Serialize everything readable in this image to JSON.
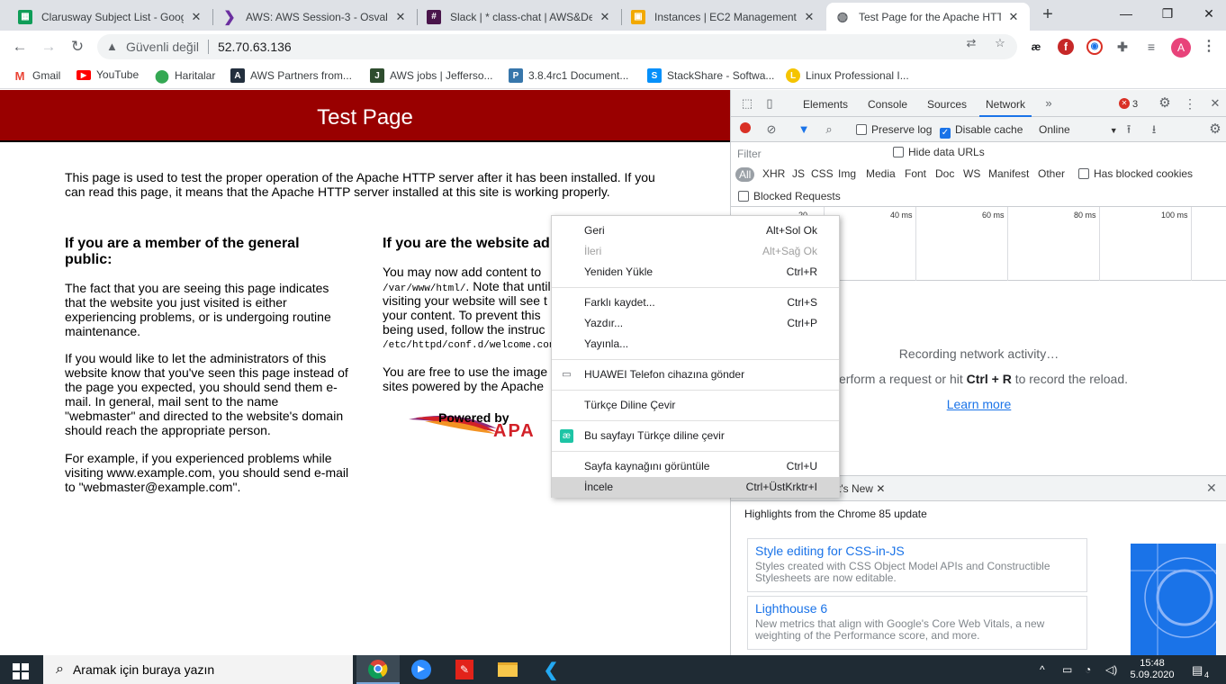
{
  "tabs": [
    {
      "title": "Clarusway Subject List - Google",
      "icon": "sheets-icon",
      "color": "#0f9d58"
    },
    {
      "title": "AWS: AWS Session-3 - Osvaldo",
      "icon": "aws-session-icon",
      "color": "#6b2fa0"
    },
    {
      "title": "Slack | * class-chat | AWS&Dev",
      "icon": "slack-icon",
      "color": "#4a154b"
    },
    {
      "title": "Instances | EC2 Management C",
      "icon": "ec2-icon",
      "color": "#f2a900"
    },
    {
      "title": "Test Page for the Apache HTTP",
      "icon": "globe-icon",
      "color": "#5f6368"
    }
  ],
  "toolbar": {
    "security_label": "Güvenli değil",
    "url": "52.70.63.136"
  },
  "bookmarks": [
    {
      "label": "Gmail",
      "icon": "gmail-icon",
      "color": "#ea4335",
      "glyph": "M"
    },
    {
      "label": "YouTube",
      "icon": "youtube-icon",
      "color": "#ff0000",
      "glyph": "▶"
    },
    {
      "label": "Haritalar",
      "icon": "maps-icon",
      "color": "#34a853",
      "glyph": "●"
    },
    {
      "label": "AWS Partners from...",
      "icon": "aws-partners-icon",
      "color": "#232f3e",
      "glyph": "A"
    },
    {
      "label": "AWS jobs | Jefferso...",
      "icon": "jobs-icon",
      "color": "#2e4d2e",
      "glyph": "J"
    },
    {
      "label": "3.8.4rc1 Document...",
      "icon": "python-icon",
      "color": "#3776ab",
      "glyph": "P"
    },
    {
      "label": "StackShare - Softwa...",
      "icon": "stackshare-icon",
      "color": "#0690fa",
      "glyph": "S"
    },
    {
      "label": "Linux Professional I...",
      "icon": "lpi-icon",
      "color": "#f5c400",
      "glyph": "L"
    }
  ],
  "page": {
    "title": "Test Page",
    "intro": "This page is used to test the proper operation of the Apache HTTP server after it has been installed. If you can read this page, it means that the Apache HTTP server installed at this site is working properly.",
    "left_heading": "If you are a member of the general public:",
    "left_p1": "The fact that you are seeing this page indicates that the website you just visited is either experiencing problems, or is undergoing routine maintenance.",
    "left_p2": "If you would like to let the administrators of this website know that you've seen this page instead of the page you expected, you should send them e-mail. In general, mail sent to the name \"webmaster\" and directed to the website's domain should reach the appropriate person.",
    "left_p3": "For example, if you experienced problems while visiting www.example.com, you should send e-mail to \"webmaster@example.com\".",
    "right_heading": "If you are the website adı",
    "right_p1_a": "You may now add content to",
    "right_p1_path": "/var/www/html/",
    "right_p1_b": ". Note that until",
    "right_p1_c": "visiting your website will see t",
    "right_p1_d": "your content. To prevent this",
    "right_p1_e": "being used, follow the instruc",
    "right_p1_path2": "/etc/httpd/conf.d/welcome.con",
    "right_p2_a": "You are free to use the image",
    "right_p2_b": "sites powered by the Apache",
    "powered_by": "Powered by",
    "apache_text": "APA"
  },
  "devtools": {
    "tabs": [
      "Elements",
      "Console",
      "Sources",
      "Network"
    ],
    "active_tab": "Network",
    "error_count": "3",
    "preserve_log": "Preserve log",
    "disable_cache": "Disable cache",
    "throttle": "Online",
    "filter_placeholder": "Filter",
    "hide_data_urls": "Hide data URLs",
    "types": [
      "All",
      "XHR",
      "JS",
      "CSS",
      "Img",
      "Media",
      "Font",
      "Doc",
      "WS",
      "Manifest",
      "Other"
    ],
    "has_blocked_cookies": "Has blocked cookies",
    "blocked_requests": "Blocked Requests",
    "ticks": [
      "20",
      "40 ms",
      "60 ms",
      "80 ms",
      "100 ms"
    ],
    "recording": "Recording network activity…",
    "hint_a": "erform a request or hit ",
    "hint_key": "Ctrl + R",
    "hint_b": " to record the reload.",
    "learn_more": "Learn more",
    "drawer_tab": "t's New",
    "highlights": "Highlights from the Chrome 85 update",
    "cards": [
      {
        "title": "Style editing for CSS-in-JS",
        "desc": "Styles created with CSS Object Model APIs and Constructible Stylesheets are now editable."
      },
      {
        "title": "Lighthouse 6",
        "desc": "New metrics that align with Google's Core Web Vitals, a new weighting of the Performance score, and more."
      }
    ]
  },
  "context_menu": {
    "items": [
      {
        "label": "Geri",
        "shortcut": "Alt+Sol Ok",
        "disabled": false
      },
      {
        "label": "İleri",
        "shortcut": "Alt+Sağ Ok",
        "disabled": true
      },
      {
        "label": "Yeniden Yükle",
        "shortcut": "Ctrl+R",
        "disabled": false
      },
      {
        "label": "Farklı kaydet...",
        "shortcut": "Ctrl+S",
        "disabled": false
      },
      {
        "label": "Yazdır...",
        "shortcut": "Ctrl+P",
        "disabled": false
      },
      {
        "label": "Yayınla...",
        "shortcut": "",
        "disabled": false
      },
      {
        "label": "HUAWEI Telefon cihazına gönder",
        "shortcut": "",
        "disabled": false
      },
      {
        "label": "Türkçe Diline Çevir",
        "shortcut": "",
        "disabled": false
      },
      {
        "label": "Bu sayfayı Türkçe diline çevir",
        "shortcut": "",
        "disabled": false
      },
      {
        "label": "Sayfa kaynağını görüntüle",
        "shortcut": "Ctrl+U",
        "disabled": false
      },
      {
        "label": "İncele",
        "shortcut": "Ctrl+ÜstKrktr+I",
        "disabled": false
      }
    ]
  },
  "taskbar": {
    "search_placeholder": "Aramak için buraya yazın",
    "time": "15:48",
    "date": "5.09.2020",
    "notifications": "4"
  }
}
